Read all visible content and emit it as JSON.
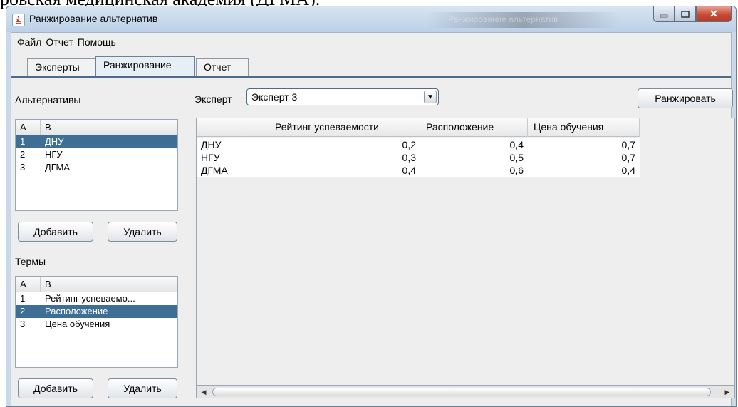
{
  "background_text": "ровская медицинская академия (ДГМА).",
  "window": {
    "title": "Ранжирование альтернатив",
    "background_app_title": "Ранжирование альтернатив"
  },
  "menu": [
    "Файл",
    "Отчет",
    "Помощь"
  ],
  "tabs": [
    "Эксперты",
    "Ранжирование",
    "Отчет"
  ],
  "active_tab": "Ранжирование",
  "alternatives": {
    "label": "Альтернативы",
    "columns": [
      "A",
      "B"
    ],
    "rows": [
      {
        "a": "1",
        "b": "ДНУ",
        "selected": true
      },
      {
        "a": "2",
        "b": "НГУ",
        "selected": false
      },
      {
        "a": "3",
        "b": "ДГМА",
        "selected": false
      }
    ],
    "add_label": "Добавить",
    "delete_label": "Удалить"
  },
  "terms": {
    "label": "Термы",
    "columns": [
      "A",
      "B"
    ],
    "rows": [
      {
        "a": "1",
        "b": "Рейтинг успеваемо...",
        "selected": false
      },
      {
        "a": "2",
        "b": "Расположение",
        "selected": true
      },
      {
        "a": "3",
        "b": "Цена обучения",
        "selected": false
      }
    ],
    "add_label": "Добавить",
    "delete_label": "Удалить"
  },
  "expert": {
    "label": "Эксперт",
    "selected": "Эксперт 3",
    "rank_button": "Ранжировать"
  },
  "grid": {
    "headers": [
      "",
      "Рейтинг успеваемости",
      "Расположение",
      "Цена обучения"
    ],
    "rows": [
      [
        "ДНУ",
        "0,2",
        "0,4",
        "0,7"
      ],
      [
        "НГУ",
        "0,3",
        "0,5",
        "0,7"
      ],
      [
        "ДГМА",
        "0,4",
        "0,6",
        "0,4"
      ]
    ]
  },
  "colors": {
    "selection": "#3d6e96",
    "tab_underline": "#4f6b89",
    "close_button": "#c74b34"
  },
  "icons": [
    "java-app-icon",
    "minimize-icon",
    "maximize-icon",
    "close-icon",
    "dropdown-arrow-icon",
    "scroll-left-icon",
    "scroll-right-icon"
  ]
}
